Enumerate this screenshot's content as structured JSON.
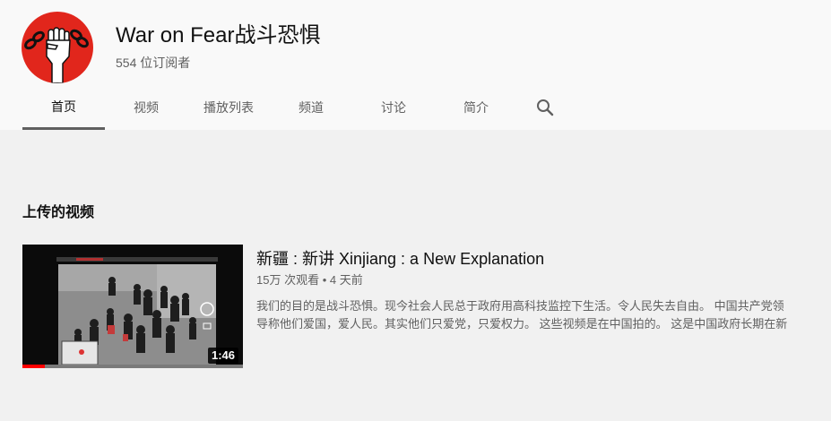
{
  "channel": {
    "title": "War on Fear战斗恐惧",
    "subscribers": "554 位订阅者",
    "avatar_icon": "raised-fist-broken-chain-icon",
    "avatar_color": "#e1261c"
  },
  "tabs": [
    {
      "label": "首页",
      "active": true
    },
    {
      "label": "视频",
      "active": false
    },
    {
      "label": "播放列表",
      "active": false
    },
    {
      "label": "频道",
      "active": false
    },
    {
      "label": "讨论",
      "active": false
    },
    {
      "label": "简介",
      "active": false
    }
  ],
  "search_icon": "search-icon",
  "section": {
    "title": "上传的视频"
  },
  "video": {
    "title": "新疆 : 新讲 Xinjiang : a New Explanation",
    "views": "15万 次观看",
    "separator": "•",
    "age": "4 天前",
    "description": "我们的目的是战斗恐惧。现今社会人民总于政府用高科技监控下生活。令人民失去自由。 中国共产党领导称他们爱国，爱人民。其实他们只爱党，只爱权力。 这些视频是在中国拍的。 这是中国政府长期在新",
    "duration": "1:46",
    "watched_fraction": 0.1,
    "progress_color": "#ff0000"
  }
}
